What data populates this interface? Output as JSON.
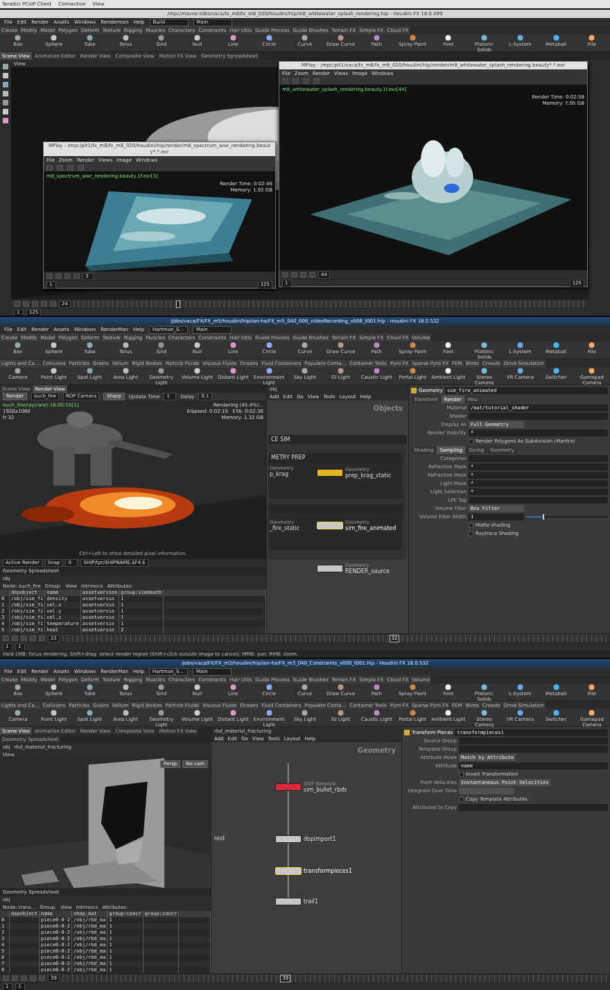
{
  "client_menu": [
    "Teradici PCoIP Client",
    "Connection",
    "View"
  ],
  "sessions": [
    {
      "kind": "mplay",
      "title": "/mpc/mavne-tdks/vaca/fx_m8/fx_m8_020/houdini/hip/m8_whitewater_splash_rendering.hip - Houdini FX 18.0.499",
      "menu": [
        "File",
        "Edit",
        "Render",
        "Assets",
        "Windows",
        "Renderman",
        "Help"
      ],
      "desktops": [
        "Build",
        "Main"
      ],
      "shelf_tabs": [
        "Create",
        "Modify",
        "Model",
        "Polygon",
        "Deform",
        "Texture",
        "Rigging",
        "Muscles",
        "Characters",
        "Constraints",
        "Hair Utils",
        "Guide Process",
        "Guide Brushes",
        "Terrain FX",
        "Simple FX",
        "Cloud FX"
      ],
      "shelf_tools": [
        "Box",
        "Sphere",
        "Tube",
        "Torus",
        "Grid",
        "Null",
        "Line",
        "Circle",
        "Curve",
        "Draw Curve",
        "Path",
        "Spray Paint",
        "Font",
        "Platonic Solids",
        "L-System",
        "Metaball",
        "File"
      ],
      "pane_tabs": [
        {
          "label": "Scene View",
          "selected": true
        },
        {
          "label": "Animation Editor",
          "selected": false
        },
        {
          "label": "Render View",
          "selected": false
        },
        {
          "label": "Composite View",
          "selected": false
        },
        {
          "label": "Motion FX View",
          "selected": false
        },
        {
          "label": "Geometry Spreadsheet",
          "selected": false
        }
      ],
      "viewport_label": "View",
      "windows": [
        {
          "title": "MPlay - /mpc/pit1/fx_m8/fx_m8_020/houdini/hip/render/m8_spectrum_wwr_rendering.beauty*.*.exr",
          "menu": [
            "File",
            "Zoom",
            "Render",
            "Views",
            "Image",
            "Windows"
          ],
          "image": "m8_spectrum_wwr_rendering.beauty.1f.exr[3]",
          "stats": [
            "Render Time: 0:02:46",
            "Memory: 1.93 GB"
          ],
          "frame": "3",
          "range": [
            "1",
            "125"
          ]
        },
        {
          "title": "MPlay - /mpc/pit1/vaca/fx_m8/fx_m8_020/houdini/hip/render/m8_whitewater_splash_rendering.beauty*.*.exr",
          "menu": [
            "File",
            "Zoom",
            "Render",
            "Views",
            "Image",
            "Windows"
          ],
          "image": "m8_whitewater_splash_rendering.beauty.1f.exr[44]",
          "stats": [
            "Render Time: 0:02:58",
            "Memory: 7.95 GB"
          ],
          "frame": "44",
          "range": [
            "1",
            "125"
          ]
        }
      ],
      "timeline": {
        "frame": "24",
        "start": "1",
        "end": "125",
        "level": 0.2
      }
    },
    {
      "kind": "render",
      "title": "/jobs/vaca/FX/FX_m5/houdini/hip/ian-ha/FX_m5_040_000_videoRecording_v006_t001.hip - Houdini FX 18.0.532",
      "menu": [
        "File",
        "Edit",
        "Render",
        "Assets",
        "Windows",
        "RenderMan",
        "Help"
      ],
      "desktops": [
        "Hartman_S...",
        "Main"
      ],
      "shelf_tabs": [
        "Create",
        "Modify",
        "Model",
        "Polygon",
        "Deform",
        "Texture",
        "Rigging",
        "Muscles",
        "Characters",
        "Constraints",
        "Hair Utils",
        "Guide Process",
        "Guide Brushes",
        "Terrain FX",
        "Simple FX",
        "Cloud FX",
        "Volume"
      ],
      "shelf_tools": [
        "Box",
        "Sphere",
        "Tube",
        "Torus",
        "Grid",
        "Null",
        "Line",
        "Circle",
        "Curve",
        "Draw Curve",
        "Path",
        "Spray Paint",
        "Font",
        "Platonic Solids",
        "L-System",
        "Metaball",
        "File"
      ],
      "shelf_tabs_2": [
        "Lights and Ca...",
        "Collisions",
        "Particles",
        "Grains",
        "Vellum",
        "Rigid Bodies",
        "Particle Fluids",
        "Viscous Fluids",
        "Oceans",
        "Fluid Containers",
        "Populate Conta...",
        "Container Tools",
        "Pyro FX",
        "Sparse Pyro FX",
        "FEM",
        "Wires",
        "Crowds",
        "Drive Simulation"
      ],
      "shelf_tools_2": [
        "Camera",
        "Point Light",
        "Spot Light",
        "Area Light",
        "Geometry Light",
        "Volume Light",
        "Distant Light",
        "Environment Light",
        "Sky Light",
        "GI Light",
        "Caustic Light",
        "Portal Light",
        "Ambient Light",
        "Stereo Camera",
        "VR Camera",
        "Switcher",
        "Gamepad Camera"
      ],
      "pane_tabs": [
        {
          "label": "Scene View",
          "selected": false
        },
        {
          "label": "Render View",
          "selected": true
        }
      ],
      "viewer": {
        "toolbar": [
          {
            "kind": "button",
            "text": "Render"
          },
          {
            "kind": "field",
            "text": "ouch_fire"
          },
          {
            "kind": "field",
            "text": "ROP Camera"
          },
          {
            "kind": "button",
            "text": "Sharp"
          },
          {
            "kind": "label",
            "text": "Update Time"
          },
          {
            "kind": "field",
            "text": "1"
          },
          {
            "kind": "label",
            "text": "Delay"
          },
          {
            "kind": "field",
            "text": "0.1"
          }
        ],
        "overlay_left": [
          "ouch_fire/ray(rare)-16:00:55[1]",
          "1920x1080",
          "fr 32"
        ],
        "overlay_right": [
          "Rendering (45.4%)...",
          "Elapsed: 0:02:10   ETA: 0:02:36",
          "Memory: 1.32 GB"
        ],
        "hint": "Ctrl+Left to show detailed pixel information.",
        "footer": [
          "Active Render",
          "Snap",
          "0",
          "SHIP/tpr/$HIPNAME.$F4.$"
        ]
      },
      "spreadsheet": {
        "tab": "Geometry Spreadsheet",
        "path": "obj",
        "filters": [
          "Node: ouch_fire",
          "Group:",
          "View",
          "Intrinsics",
          "Attributes:"
        ],
        "columns": [
          "",
          "dopobject",
          "name",
          "assetversion",
          "group:simdeath"
        ],
        "rows": [
          [
            "0",
            "/obj/sim_fi",
            "density",
            "assetversio",
            "1"
          ],
          [
            "1",
            "/obj/sim_fi",
            "vel.x",
            "assetversio",
            "1"
          ],
          [
            "2",
            "/obj/sim_fi",
            "vel.y",
            "assetversio",
            "1"
          ],
          [
            "3",
            "/obj/sim_fi",
            "vel.z",
            "assetversio",
            "1"
          ],
          [
            "4",
            "/obj/sim_fi",
            "temperature",
            "assetversio",
            "1"
          ],
          [
            "5",
            "/obj/sim_fi",
            "heat",
            "assetversio",
            "2"
          ]
        ]
      },
      "network": {
        "path": "obj",
        "menu": [
          "Add",
          "Edit",
          "Go",
          "View",
          "Tools",
          "Layout",
          "Help"
        ],
        "context": "Objects",
        "boxes": [
          "CE SIM",
          "METRY PREP"
        ],
        "nodes": [
          {
            "kind": "stub",
            "type": "Geometry",
            "name": "p_krag",
            "selected": false
          },
          {
            "kind": "node",
            "type": "Geometry",
            "name": "prep_krag_static",
            "color": "#e8b820",
            "selected": false
          },
          {
            "kind": "stub",
            "type": "Geometry",
            "name": "_fire_static",
            "selected": false
          },
          {
            "kind": "node",
            "type": "Geometry",
            "name": "sim_fire_animated",
            "color": "#c8c8c8",
            "selected": true
          },
          {
            "kind": "node",
            "type": "Geometry",
            "name": "RENDER_source",
            "color": "#c8c8c8",
            "selected": false
          }
        ]
      },
      "params": {
        "type": "Geometry",
        "name": "sim_fire_animated",
        "tabs": [
          {
            "label": "Transform",
            "selected": false
          },
          {
            "label": "Render",
            "selected": true
          },
          {
            "label": "Misc",
            "selected": false
          }
        ],
        "rows": [
          {
            "kind": "field",
            "label": "Material",
            "value": "/mat/tutorial_shader"
          },
          {
            "kind": "field",
            "label": "Shader"
          },
          {
            "kind": "menu",
            "label": "Display As",
            "value": "Full Geometry"
          },
          {
            "kind": "field",
            "label": "Render Visibility",
            "value": "*"
          },
          {
            "kind": "check",
            "label": "Render Polygons As Subdivision (Mantra)",
            "checked": false
          },
          {
            "kind": "tabs",
            "items": [
              {
                "label": "Shading",
                "selected": false
              },
              {
                "label": "Sampling",
                "selected": true
              },
              {
                "label": "Dicing",
                "selected": false
              },
              {
                "label": "Geometry",
                "selected": false
              }
            ]
          },
          {
            "kind": "field",
            "label": "Categories"
          },
          {
            "kind": "field",
            "label": "Reflection Mask",
            "value": "*"
          },
          {
            "kind": "field",
            "label": "Refraction Mask",
            "value": "*"
          },
          {
            "kind": "field",
            "label": "Light Mask",
            "value": "*"
          },
          {
            "kind": "field",
            "label": "Light Selection",
            "value": "*"
          },
          {
            "kind": "field",
            "label": "LPE Tag"
          },
          {
            "kind": "menu",
            "label": "Volume Filter",
            "value": "Box Filter"
          },
          {
            "kind": "slider",
            "label": "Volume Filter Width",
            "value": "1",
            "level": 0.2
          },
          {
            "kind": "check",
            "label": "Matte shading",
            "checked": false
          },
          {
            "kind": "check",
            "label": "Raytrace Shading",
            "checked": false
          }
        ]
      },
      "timeline": {
        "frame": "22",
        "start": "1",
        "end": "1",
        "level": 0.6,
        "marker": "32"
      },
      "status": "Hold LMB: focus rendering. Shift+drag: select render region (Shift+click outside image to cancel). MMB: pan. RMB: zoom."
    },
    {
      "kind": "rbd",
      "title": "/jobs/vaca/FX/FX_m3/houdini/hip/ian-ha/FX_m3_040_Constraints_v000_t001.hip - Houdini FX 18.0.532",
      "menu": [
        "File",
        "Edit",
        "Render",
        "Assets",
        "Windows",
        "RenderMan",
        "Help"
      ],
      "desktops": [
        "Hartman_S...",
        "Main"
      ],
      "shelf_tabs": [
        "Create",
        "Modify",
        "Model",
        "Polygon",
        "Deform",
        "Texture",
        "Rigging",
        "Muscles",
        "Characters",
        "Constraints",
        "Hair Utils",
        "Guide Process",
        "Guide Brushes",
        "Terrain FX",
        "Simple FX",
        "Cloud FX",
        "Volume"
      ],
      "shelf_tools": [
        "Box",
        "Sphere",
        "Tube",
        "Torus",
        "Grid",
        "Null",
        "Line",
        "Circle",
        "Curve",
        "Draw Curve",
        "Path",
        "Spray Paint",
        "Font",
        "Platonic Solids",
        "L-System",
        "Metaball",
        "File"
      ],
      "shelf_tabs_2": [
        "Lights and Ca...",
        "Collisions",
        "Particles",
        "Grains",
        "Vellum",
        "Rigid Bodies",
        "Particle Fluids",
        "Viscous Fluids",
        "Oceans",
        "Fluid Containers",
        "Populate Conta...",
        "Container Tools",
        "Pyro FX",
        "Sparse Pyro FX",
        "FEM",
        "Wires",
        "Crowds",
        "Drive Simulation"
      ],
      "shelf_tools_2": [
        "Camera",
        "Point Light",
        "Spot Light",
        "Area Light",
        "Geometry Light",
        "Volume Light",
        "Distant Light",
        "Environment Light",
        "Sky Light",
        "GI Light",
        "Caustic Light",
        "Portal Light",
        "Ambient Light",
        "Stereo Camera",
        "VR Camera",
        "Switcher",
        "Gamepad Camera"
      ],
      "pane_tabs": [
        {
          "label": "Scene View",
          "selected": true
        },
        {
          "label": "Animation Editor",
          "selected": false
        },
        {
          "label": "Render View",
          "selected": false
        },
        {
          "label": "Composite View",
          "selected": false
        },
        {
          "label": "Motion FX View",
          "selected": false
        },
        {
          "label": "Geometry Spreadsheet",
          "selected": false
        }
      ],
      "viewer": {
        "path": [
          "obj",
          "rbd_material_fracturing"
        ],
        "label": "View",
        "buttons": [
          "Persp",
          "No cam"
        ]
      },
      "spreadsheet": {
        "tab": "Geometry Spreadsheet",
        "path": "obj",
        "filters": [
          "Node: trans...",
          "Group:",
          "View",
          "Intrinsics",
          "Attributes:"
        ],
        "columns": [
          "",
          "dopobject",
          "name",
          "shop_mat",
          "group:concr",
          "group:concr"
        ],
        "rows": [
          [
            "0",
            "",
            "piece0-0-2",
            "/obj/rbd_ma",
            "1"
          ],
          [
            "1",
            "",
            "piece0-0-2",
            "/obj/rbd_ma",
            "1"
          ],
          [
            "2",
            "",
            "piece0-0-2",
            "/obj/rbd_ma",
            "1"
          ],
          [
            "3",
            "",
            "piece0-0-2",
            "/obj/rbd_ma",
            "1"
          ],
          [
            "4",
            "",
            "piece0-0-2",
            "/obj/rbd_ma",
            "1"
          ],
          [
            "5",
            "",
            "piece0-0-2",
            "/obj/rbd_ma",
            "1"
          ],
          [
            "6",
            "",
            "piece0-0-2",
            "/obj/rbd_ma",
            "1"
          ],
          [
            "7",
            "",
            "piece0-0-2",
            "/obj/rbd_ma",
            "1"
          ],
          [
            "8",
            "",
            "piece0-0-2",
            "/obj/rbd_ma",
            "1"
          ]
        ]
      },
      "network": {
        "path": "rbd_material_fracturing",
        "menu": [
          "Add",
          "Edit",
          "Go",
          "View",
          "Tools",
          "Layout",
          "Help"
        ],
        "context": "Geometry",
        "nodes": [
          {
            "kind": "stub",
            "name": "rest",
            "selected": false
          },
          {
            "kind": "node",
            "type": "DOP Network",
            "name": "sim_bullet_rbds",
            "color": "#d8283a",
            "selected": false
          },
          {
            "kind": "node",
            "name": "dopimport1",
            "color": "#c8c8c8",
            "selected": false
          },
          {
            "kind": "node",
            "name": "transformpieces1",
            "color": "#c8c8c8",
            "selected": true
          },
          {
            "kind": "node",
            "name": "trail1",
            "color": "#c8c8c8",
            "selected": false
          }
        ]
      },
      "params": {
        "type": "Transform Pieces",
        "name": "transformpieces1",
        "rows": [
          {
            "kind": "field",
            "label": "Source Group"
          },
          {
            "kind": "field",
            "label": "Template Group"
          },
          {
            "kind": "menu",
            "label": "Attribute Mode",
            "value": "Match by Attribute"
          },
          {
            "kind": "field",
            "label": "Attribute",
            "value": "name"
          },
          {
            "kind": "check",
            "label": "Invert Transformation",
            "checked": false
          },
          {
            "kind": "menu",
            "label": "Point Velocities",
            "value": "Instantaneous Point Velocities"
          },
          {
            "kind": "menu",
            "label": "Integrate Over Time"
          },
          {
            "kind": "check",
            "label": "Copy Template Attributes",
            "checked": false
          },
          {
            "kind": "field",
            "label": "Attributes to Copy"
          }
        ]
      },
      "timeline": {
        "frame": "39",
        "start": "1",
        "end": "1",
        "level": 0.4,
        "marker": "39"
      }
    }
  ]
}
